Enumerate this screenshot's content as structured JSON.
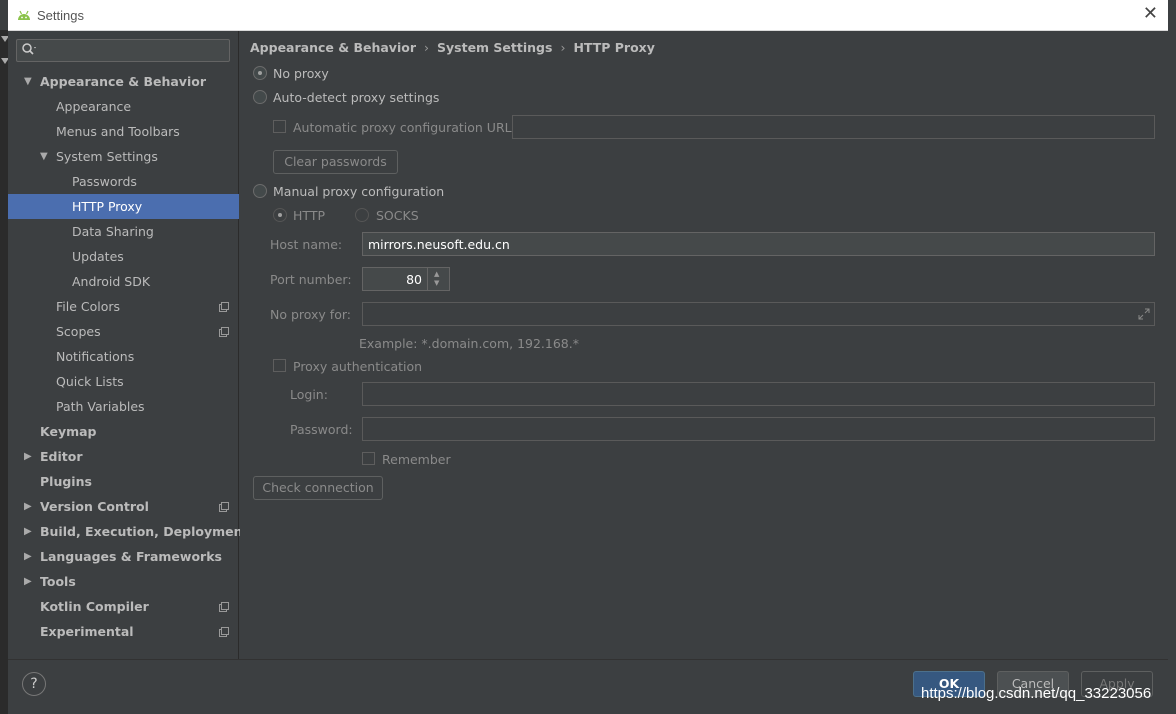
{
  "window": {
    "title": "Settings",
    "close_glyph": "✕"
  },
  "search": {
    "placeholder": "",
    "icon": "search-icon"
  },
  "sidebar": {
    "items": [
      {
        "label": "Appearance & Behavior",
        "level": 0,
        "expanded": true,
        "bold": true
      },
      {
        "label": "Appearance",
        "level": 1
      },
      {
        "label": "Menus and Toolbars",
        "level": 1
      },
      {
        "label": "System Settings",
        "level": 1,
        "expanded": true
      },
      {
        "label": "Passwords",
        "level": 2
      },
      {
        "label": "HTTP Proxy",
        "level": 2,
        "selected": true
      },
      {
        "label": "Data Sharing",
        "level": 2
      },
      {
        "label": "Updates",
        "level": 2
      },
      {
        "label": "Android SDK",
        "level": 2
      },
      {
        "label": "File Colors",
        "level": 1,
        "project": true
      },
      {
        "label": "Scopes",
        "level": 1,
        "project": true
      },
      {
        "label": "Notifications",
        "level": 1
      },
      {
        "label": "Quick Lists",
        "level": 1
      },
      {
        "label": "Path Variables",
        "level": 1
      },
      {
        "label": "Keymap",
        "level": 0,
        "bold": true
      },
      {
        "label": "Editor",
        "level": 0,
        "collapsed": true,
        "bold": true
      },
      {
        "label": "Plugins",
        "level": 0,
        "bold": true
      },
      {
        "label": "Version Control",
        "level": 0,
        "collapsed": true,
        "bold": true,
        "project": true
      },
      {
        "label": "Build, Execution, Deployment",
        "level": 0,
        "collapsed": true,
        "bold": true
      },
      {
        "label": "Languages & Frameworks",
        "level": 0,
        "collapsed": true,
        "bold": true
      },
      {
        "label": "Tools",
        "level": 0,
        "collapsed": true,
        "bold": true
      },
      {
        "label": "Kotlin Compiler",
        "level": 0,
        "bold": true,
        "project": true
      },
      {
        "label": "Experimental",
        "level": 0,
        "bold": true,
        "project": true
      }
    ]
  },
  "breadcrumb": {
    "parts": [
      "Appearance & Behavior",
      "System Settings",
      "HTTP Proxy"
    ],
    "separator": "›"
  },
  "proxy": {
    "no_proxy": "No proxy",
    "auto_detect": "Auto-detect proxy settings",
    "auto_config_url_label": "Automatic proxy configuration URL:",
    "auto_config_url_value": "",
    "clear_passwords": "Clear passwords",
    "manual": "Manual proxy configuration",
    "http": "HTTP",
    "socks": "SOCKS",
    "host_label": "Host name:",
    "host_value": "mirrors.neusoft.edu.cn",
    "port_label": "Port number:",
    "port_value": "80",
    "no_proxy_for_label": "No proxy for:",
    "no_proxy_for_value": "",
    "example": "Example: *.domain.com, 192.168.*",
    "proxy_auth": "Proxy authentication",
    "login_label": "Login:",
    "login_value": "",
    "password_label": "Password:",
    "password_value": "",
    "remember": "Remember",
    "check_connection": "Check connection"
  },
  "footer": {
    "help": "?",
    "ok": "OK",
    "cancel": "Cancel",
    "apply": "Apply"
  },
  "watermark": "https://blog.csdn.net/qq_33223056",
  "colors": {
    "selection": "#4b6eaf",
    "background": "#3c3f41",
    "ok_button": "#365880"
  }
}
